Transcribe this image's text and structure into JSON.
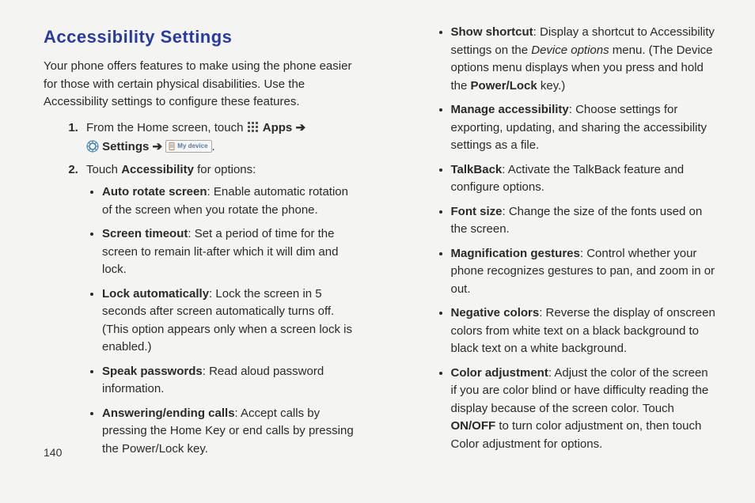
{
  "page_number": "140",
  "heading": "Accessibility Settings",
  "intro": "Your phone offers features to make using the phone easier for those with certain physical disabilities. Use the Accessibility settings to configure these features.",
  "step1": {
    "prefix": "From the Home screen, touch ",
    "apps": "Apps",
    "arrow1": "➔",
    "settings": "Settings",
    "arrow2": "➔",
    "mydevice": "My device",
    "suffix": "."
  },
  "step2": {
    "prefix": "Touch ",
    "bold": "Accessibility",
    "suffix": " for options:"
  },
  "left_bullets": [
    {
      "t": "Auto rotate screen",
      "d": ": Enable automatic rotation of the screen when you rotate the phone."
    },
    {
      "t": "Screen timeout",
      "d": ": Set a period of time for the screen to remain lit-after which it will dim and lock."
    },
    {
      "t": "Lock automatically",
      "d": ": Lock the screen in 5 seconds after screen automatically turns off. (This option appears only when a screen lock is enabled.)"
    },
    {
      "t": "Speak passwords",
      "d": ": Read aloud password information."
    },
    {
      "t": "Answering/ending calls",
      "d": ": Accept calls by pressing the Home Key or end calls by pressing the Power/Lock key."
    }
  ],
  "right_bullets": [
    {
      "t": "Show shortcut",
      "pre": ": Display a shortcut to Accessibility settings on the ",
      "it": "Device options",
      "mid": " menu. (The Device options menu displays when you press and hold the ",
      "b2": "Power/Lock",
      "post": " key.)"
    },
    {
      "t": "Manage accessibility",
      "d": ": Choose settings for exporting, updating, and sharing the accessibility settings as a file."
    },
    {
      "t": "TalkBack",
      "d": ": Activate the TalkBack feature and configure options."
    },
    {
      "t": "Font size",
      "d": ": Change the size of the fonts used on the screen."
    },
    {
      "t": "Magnification gestures",
      "d": ": Control whether your phone recognizes gestures to pan, and zoom in or out."
    },
    {
      "t": "Negative colors",
      "d": ": Reverse the display of onscreen colors from white text on a black background to black text on a white background."
    },
    {
      "t": "Color adjustment",
      "pre": ": Adjust the color of the screen if you are color blind or have difficulty reading the display because of the screen color. Touch ",
      "b2": "ON/OFF",
      "post": " to turn color adjustment on, then touch Color adjustment for options."
    }
  ]
}
